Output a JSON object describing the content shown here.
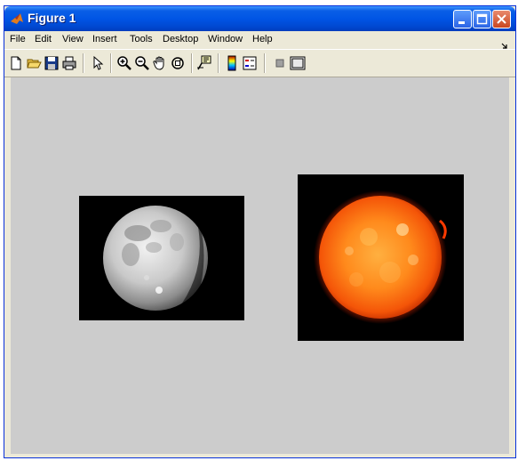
{
  "window": {
    "title": "Figure 1",
    "buttons": [
      "minimize",
      "maximize",
      "close"
    ]
  },
  "menubar": {
    "items": [
      "File",
      "Edit",
      "View",
      "Insert",
      "Tools",
      "Desktop",
      "Window",
      "Help"
    ]
  },
  "toolbar": {
    "tools": [
      "new-figure-icon",
      "open-file-icon",
      "save-icon",
      "print-icon",
      "edit-plot-arrow-icon",
      "zoom-in-icon",
      "zoom-out-icon",
      "pan-hand-icon",
      "rotate-3d-icon",
      "data-cursor-icon",
      "insert-colorbar-icon",
      "insert-legend-icon",
      "hide-plot-tools-icon",
      "show-plot-tools-icon"
    ]
  },
  "figure": {
    "background": "#cccccc",
    "axes": [
      {
        "image": "moon",
        "background": "#000000"
      },
      {
        "image": "sun",
        "background": "#000000"
      }
    ]
  }
}
